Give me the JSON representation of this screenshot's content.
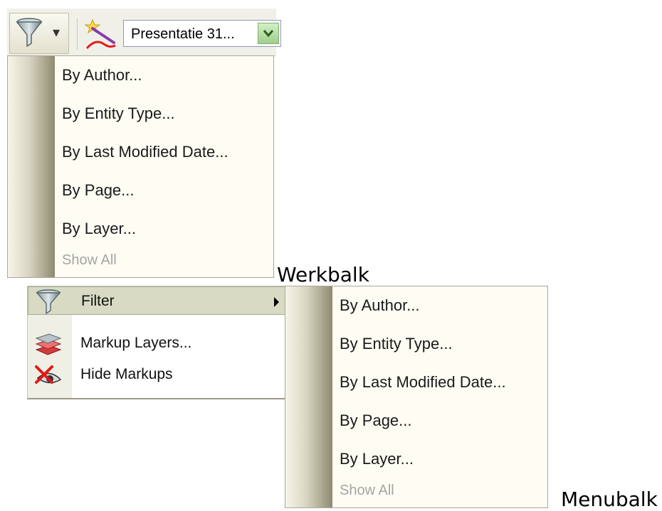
{
  "toolbar": {
    "filter_icon": "funnel-icon",
    "dropdown_caret": "▾",
    "wand_icon": "magic-wand-icon",
    "document_select_value": "Presentatie 31..."
  },
  "toolbar_menu": {
    "items": [
      {
        "label": "By Author...",
        "enabled": true
      },
      {
        "label": "By Entity Type...",
        "enabled": true
      },
      {
        "label": "By Last Modified Date...",
        "enabled": true
      },
      {
        "label": "By Page...",
        "enabled": true
      },
      {
        "label": "By Layer...",
        "enabled": true
      },
      {
        "label": "Show All",
        "enabled": false
      }
    ]
  },
  "captions": {
    "toolbar": "Werkbalk",
    "menubar": "Menubalk"
  },
  "main_menu": {
    "items": [
      {
        "label": "Filter",
        "icon": "funnel-icon",
        "has_submenu": true,
        "highlighted": true
      },
      {
        "label": "Markup Layers...",
        "icon": "layers-icon",
        "has_submenu": false
      },
      {
        "label": "Hide Markups",
        "icon": "hide-markups-icon",
        "has_submenu": false
      }
    ]
  },
  "filter_submenu": {
    "items": [
      {
        "label": "By Author...",
        "enabled": true
      },
      {
        "label": "By Entity Type...",
        "enabled": true
      },
      {
        "label": "By Last Modified Date...",
        "enabled": true
      },
      {
        "label": "By Page...",
        "enabled": true
      },
      {
        "label": "By Layer...",
        "enabled": true
      },
      {
        "label": "Show All",
        "enabled": false
      }
    ]
  },
  "colors": {
    "menu_background": "#fffdf3",
    "gutter_dark": "#8e8b70",
    "highlight": "#d8dac4",
    "disabled_text": "#a4a4a4"
  }
}
